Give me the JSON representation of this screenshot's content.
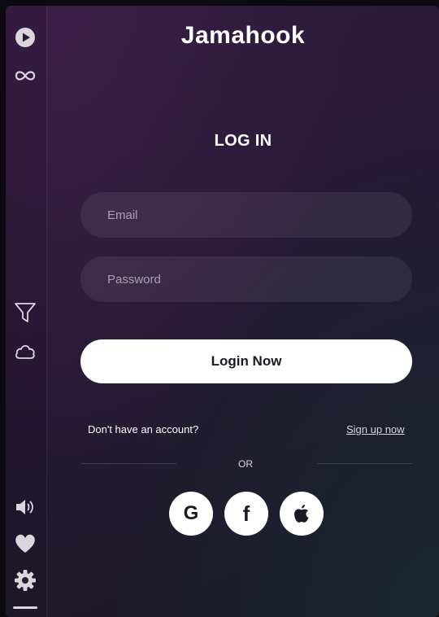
{
  "app": {
    "logo": "Jamahook"
  },
  "sidebar": {
    "items": [
      {
        "icon": "play-icon"
      },
      {
        "icon": "infinity-icon"
      },
      {
        "icon": "filter-icon"
      },
      {
        "icon": "cloud-icon"
      },
      {
        "icon": "volume-icon"
      },
      {
        "icon": "heart-icon"
      },
      {
        "icon": "gear-icon"
      }
    ]
  },
  "login": {
    "title": "LOG IN",
    "email_placeholder": "Email",
    "email_value": "",
    "password_placeholder": "Password",
    "password_value": "",
    "submit_label": "Login Now",
    "account_prompt": "Don't have an account?",
    "signup_label": "Sign up now",
    "or_label": "OR"
  },
  "social": {
    "google_label": "G",
    "facebook_label": "f"
  },
  "colors": {
    "background_top": "#2f1b3d",
    "background_bottom": "#1c1a28",
    "button": "#ffffff",
    "text": "#ffffff",
    "muted_text": "#d9d6de"
  }
}
